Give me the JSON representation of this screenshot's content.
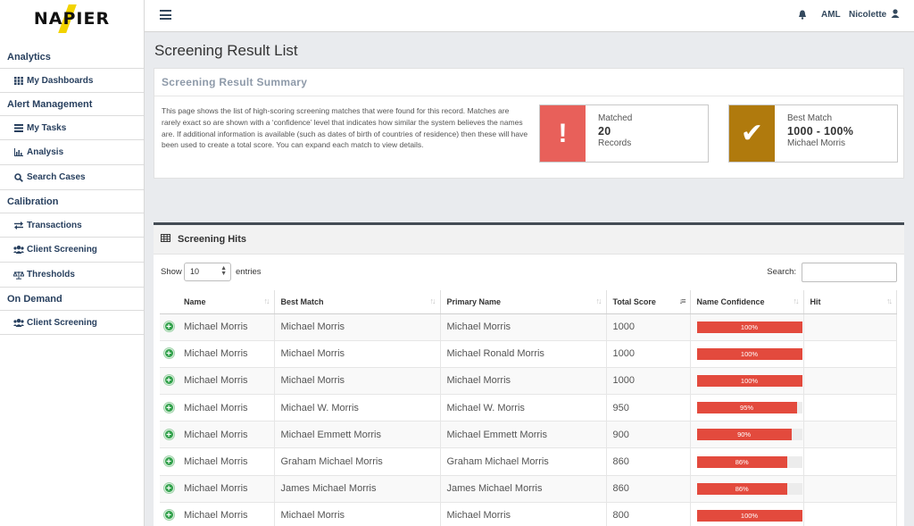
{
  "brand": {
    "logo_text": "NAPIER"
  },
  "topbar": {
    "aml_label": "AML",
    "user_name": "Nicolette"
  },
  "sidebar": {
    "sections": [
      {
        "label": "Analytics",
        "items": [
          {
            "label": "My Dashboards",
            "icon": "grid-icon"
          }
        ]
      },
      {
        "label": "Alert Management",
        "items": [
          {
            "label": "My Tasks",
            "icon": "tasks-icon"
          },
          {
            "label": "Analysis",
            "icon": "bar-chart-icon"
          },
          {
            "label": "Search Cases",
            "icon": "search-icon"
          }
        ]
      },
      {
        "label": "Calibration",
        "items": [
          {
            "label": "Transactions",
            "icon": "exchange-icon"
          },
          {
            "label": "Client Screening",
            "icon": "users-icon"
          },
          {
            "label": "Thresholds",
            "icon": "balance-scale-icon"
          }
        ]
      },
      {
        "label": "On Demand",
        "items": [
          {
            "label": "Client Screening",
            "icon": "users-icon"
          }
        ]
      }
    ]
  },
  "page": {
    "title": "Screening Result List"
  },
  "summary": {
    "title": "Screening Result Summary",
    "description": "This page shows the list of high-scoring screening matches that were found for this record. Matches are rarely exact so are shown with a ‘confidence’ level that indicates how similar the system believes the names are. If additional information is available (such as dates of birth of countries of residence) then these will have been used to create a total score. You can expand each match to view details.",
    "matched": {
      "label": "Matched",
      "value": "20",
      "sub": "Records",
      "icon_char": "!",
      "color": "#e8605a"
    },
    "best_match": {
      "label": "Best Match",
      "value": "1000 - 100%",
      "sub": "Michael Morris",
      "icon_char": "✔",
      "color": "#b07a0d"
    }
  },
  "hits": {
    "title": "Screening Hits",
    "show_label": "Show",
    "page_length": "10",
    "entries_label": "entries",
    "search_label": "Search:",
    "columns": [
      "Name",
      "Best Match",
      "Primary Name",
      "Total Score",
      "Name Confidence",
      "Hit"
    ],
    "rows": [
      {
        "name": "Michael Morris",
        "best_match": "Michael Morris",
        "primary_name": "Michael Morris",
        "total_score": "1000",
        "confidence": 100,
        "confidence_label": "100%",
        "hit": ""
      },
      {
        "name": "Michael Morris",
        "best_match": "Michael Morris",
        "primary_name": "Michael Ronald Morris",
        "total_score": "1000",
        "confidence": 100,
        "confidence_label": "100%",
        "hit": ""
      },
      {
        "name": "Michael Morris",
        "best_match": "Michael Morris",
        "primary_name": "Michael Morris",
        "total_score": "1000",
        "confidence": 100,
        "confidence_label": "100%",
        "hit": ""
      },
      {
        "name": "Michael Morris",
        "best_match": "Michael W. Morris",
        "primary_name": "Michael W. Morris",
        "total_score": "950",
        "confidence": 95,
        "confidence_label": "95%",
        "hit": ""
      },
      {
        "name": "Michael Morris",
        "best_match": "Michael Emmett Morris",
        "primary_name": "Michael Emmett Morris",
        "total_score": "900",
        "confidence": 90,
        "confidence_label": "90%",
        "hit": ""
      },
      {
        "name": "Michael Morris",
        "best_match": "Graham Michael Morris",
        "primary_name": "Graham Michael Morris",
        "total_score": "860",
        "confidence": 86,
        "confidence_label": "86%",
        "hit": ""
      },
      {
        "name": "Michael Morris",
        "best_match": "James Michael Morris",
        "primary_name": "James Michael Morris",
        "total_score": "860",
        "confidence": 86,
        "confidence_label": "86%",
        "hit": ""
      },
      {
        "name": "Michael Morris",
        "best_match": "Michael Morris",
        "primary_name": "Michael Morris",
        "total_score": "800",
        "confidence": 100,
        "confidence_label": "100%",
        "hit": ""
      }
    ]
  }
}
